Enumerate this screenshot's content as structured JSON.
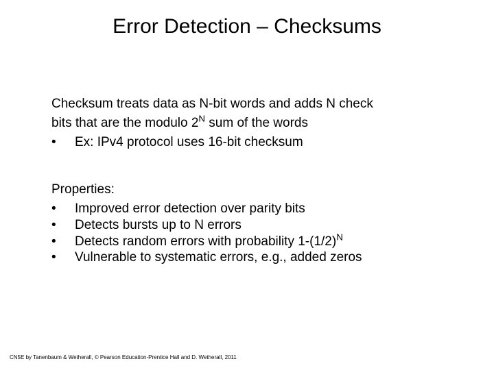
{
  "title": "Error Detection – Checksums",
  "block1": {
    "line1": "Checksum treats data as N-bit words and adds N check",
    "line2_a": "bits that are the modulo 2",
    "line2_sup": "N",
    "line2_b": " sum of the words",
    "bullet1": "Ex: IPv4 protocol uses 16-bit checksum"
  },
  "block2": {
    "heading": "Properties:",
    "b1": "Improved error detection over parity bits",
    "b2": "Detects bursts up to N errors",
    "b3_a": "Detects random errors with probability 1-(1/2)",
    "b3_sup": "N",
    "b4": "Vulnerable to systematic errors, e.g., added zeros"
  },
  "bullet": "•",
  "footer": "CN5E by Tanenbaum & Wetherall, © Pearson Education-Prentice Hall and D. Wetherall, 2011"
}
